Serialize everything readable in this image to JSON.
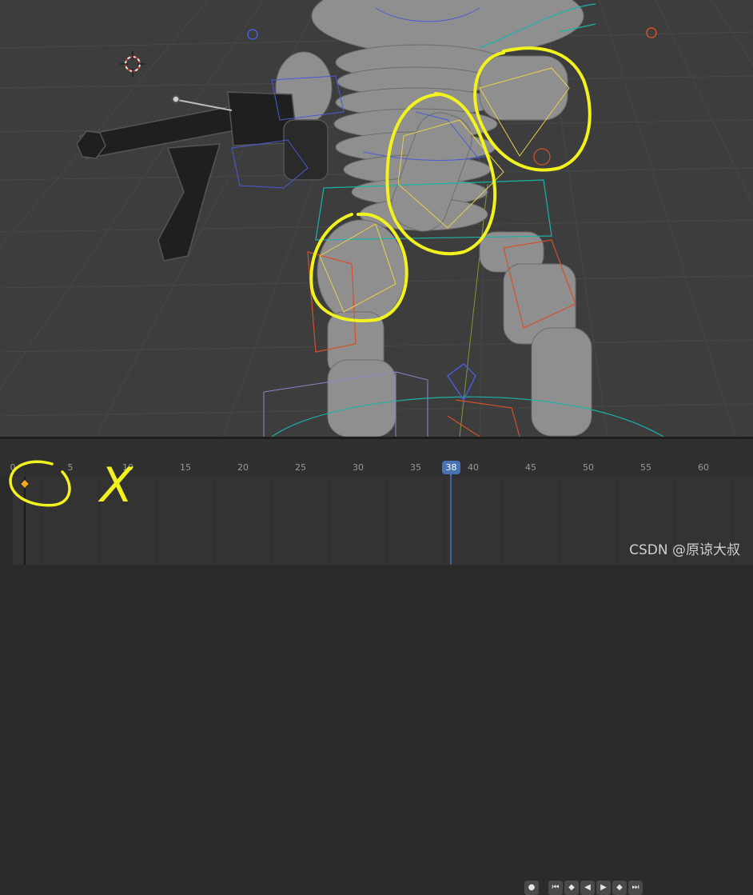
{
  "timeline": {
    "current_frame": "38",
    "frame_labels": [
      "0",
      "5",
      "10",
      "15",
      "20",
      "25",
      "30",
      "35",
      "40",
      "45",
      "50",
      "55",
      "60"
    ],
    "keyframe_frame": 1,
    "transport_icons": [
      "record-icon",
      "jump-start-icon",
      "prev-keyframe-icon",
      "play-reverse-icon",
      "play-icon",
      "next-keyframe-icon",
      "jump-end-icon"
    ]
  },
  "annotations": {
    "x_mark": "X"
  },
  "watermark": "CSDN @原谅大叔",
  "colors": {
    "annotation": "#f2f21f",
    "playhead": "#4772b3",
    "keyframe": "#f5a623",
    "armature_blue": "#4a5bd6",
    "armature_orange": "#d4502a",
    "armature_cyan": "#1bb3a8",
    "selected_bone": "#e8d24a"
  }
}
